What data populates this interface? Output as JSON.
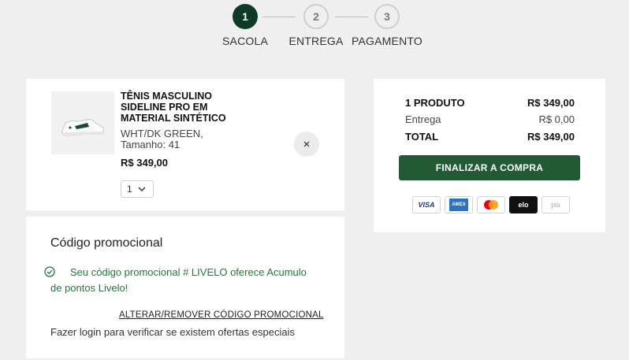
{
  "steps": [
    {
      "number": "1",
      "label": "SACOLA",
      "active": true
    },
    {
      "number": "2",
      "label": "ENTREGA",
      "active": false
    },
    {
      "number": "3",
      "label": "PAGAMENTO",
      "active": false
    }
  ],
  "cart": {
    "product_name": "TÊNIS MASCULINO SIDELINE PRO EM MATERIAL SINTÉTICO",
    "variant": "WHT/DK GREEN, Tamanho: 41",
    "price": "R$ 349,00",
    "quantity": "1",
    "remove_icon": "close-icon"
  },
  "promo": {
    "title": "Código promocional",
    "message": "Seu código promocional # LIVELO oferece Acumulo de pontos Livelo!",
    "change_link": "ALTERAR/REMOVER CÓDIGO PROMOCIONAL",
    "login_text": "Fazer login para verificar se existem ofertas especiais"
  },
  "summary": {
    "products_label": "1 PRODUTO",
    "products_value": "R$ 349,00",
    "delivery_label": "Entrega",
    "delivery_value": "R$ 0,00",
    "total_label": "TOTAL",
    "total_value": "R$ 349,00",
    "checkout_button": "FINALIZAR A COMPRA",
    "payment_methods": [
      "VISA",
      "AMEX",
      "mastercard",
      "elo",
      "pix"
    ]
  },
  "colors": {
    "brand_dark_green": "#0e3b26",
    "button_green": "#215a35",
    "promo_green": "#1f7a3a",
    "background": "#efefef"
  }
}
